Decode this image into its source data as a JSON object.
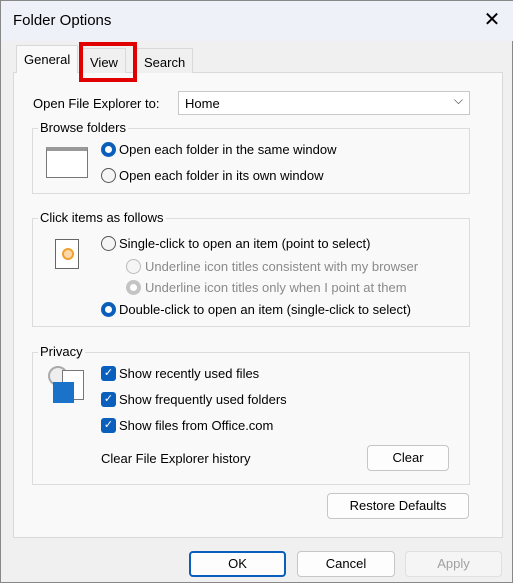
{
  "window": {
    "title": "Folder Options",
    "close_icon": "close-icon"
  },
  "tabs": [
    {
      "label": "General",
      "active": true
    },
    {
      "label": "View",
      "highlighted": true,
      "highlight_color": "#e00000"
    },
    {
      "label": "Search"
    }
  ],
  "open_to": {
    "label": "Open File Explorer to:",
    "value": "Home"
  },
  "browse": {
    "title": "Browse folders",
    "options": [
      {
        "label": "Open each folder in the same window",
        "selected": true
      },
      {
        "label": "Open each folder in its own window",
        "selected": false
      }
    ]
  },
  "click": {
    "title": "Click items as follows",
    "single": "Single-click to open an item (point to select)",
    "sub": [
      "Underline icon titles consistent with my browser",
      "Underline icon titles only when I point at them"
    ],
    "double": "Double-click to open an item (single-click to select)"
  },
  "privacy": {
    "title": "Privacy",
    "checks": [
      {
        "label": "Show recently used files",
        "checked": true
      },
      {
        "label": "Show frequently used folders",
        "checked": true
      },
      {
        "label": "Show files from Office.com",
        "checked": true
      }
    ],
    "clear_label": "Clear File Explorer history",
    "clear_button": "Clear"
  },
  "buttons": {
    "restore": "Restore Defaults",
    "ok": "OK",
    "cancel": "Cancel",
    "apply": "Apply"
  },
  "accent": "#0a5fbd"
}
